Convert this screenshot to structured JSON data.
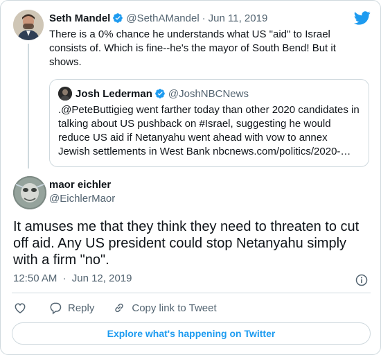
{
  "parent_tweet": {
    "author_name": "Seth Mandel",
    "author_handle": "@SethAMandel",
    "separator": "·",
    "date": "Jun 11, 2019",
    "text_lines": [
      "There is a 0% chance he understands what US \"aid\" to Israel",
      "consists of. Which is fine--he's the mayor of South Bend! But it",
      "shows."
    ],
    "quoted": {
      "author_name": "Josh Lederman",
      "author_handle": "@JoshNBCNews",
      "text_lines": [
        ".@PeteButtigieg went farther today than other 2020 candidates in",
        "talking about US pushback on #Israel, suggesting he would",
        "reduce US aid if Netanyahu went ahead with vow to annex",
        "Jewish settlements in West Bank nbcnews.com/politics/2020-…"
      ]
    }
  },
  "main_tweet": {
    "author_name": "maor eichler",
    "author_handle": "@EichlerMaor",
    "text_lines": [
      "It amuses me that they think they need to threaten to cut",
      "off aid.  Any US president could stop Netanyahu simply",
      "with a firm \"no\"."
    ],
    "time": "12:50 AM",
    "separator": "·",
    "date": "Jun 12, 2019"
  },
  "actions": {
    "reply_label": "Reply",
    "copy_link_label": "Copy link to Tweet"
  },
  "explore_label": "Explore what's happening on Twitter",
  "colors": {
    "accent": "#1d9bf0",
    "secondary_text": "#536471",
    "border": "#cfd9de"
  },
  "icons": [
    "twitter-logo-icon",
    "verified-badge-icon",
    "info-icon",
    "heart-icon",
    "reply-icon",
    "link-icon"
  ]
}
